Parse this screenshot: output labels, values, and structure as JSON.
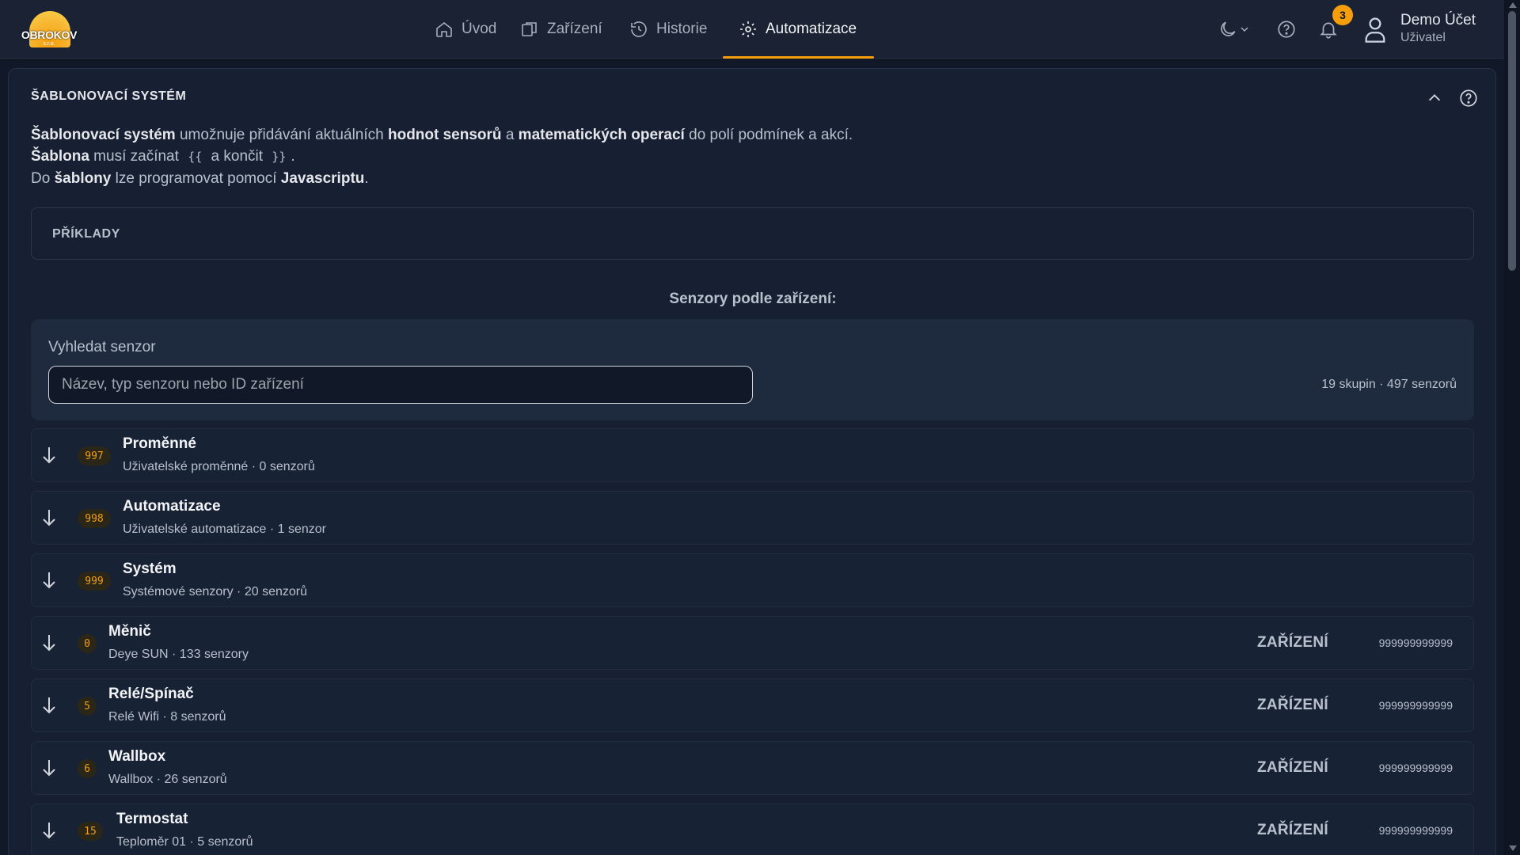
{
  "app": {
    "logo_text": "OBROKOV",
    "logo_sub": "s.r.o."
  },
  "nav": {
    "items": [
      {
        "label": "Úvod",
        "icon": "home-icon"
      },
      {
        "label": "Zařízení",
        "icon": "devices-icon"
      },
      {
        "label": "Historie",
        "icon": "history-icon"
      },
      {
        "label": "Automatizace",
        "icon": "gear-icon",
        "active": true
      }
    ]
  },
  "header": {
    "notifications_count": "3",
    "user_name": "Demo Účet",
    "user_role": "Uživatel",
    "accent_color": "#f59e0b"
  },
  "panel": {
    "title": "ŠABLONOVACÍ SYSTÉM",
    "desc": {
      "l1_b1": "Šablonovací systém",
      "l1_t1": " umožnuje přidávání aktuálních ",
      "l1_b2": "hodnot sensorů",
      "l1_t2": " a ",
      "l1_b3": "matematických operací",
      "l1_t3": " do polí podmínek a akcí.",
      "l2_b1": "Šablona",
      "l2_t1": " musí začínat ",
      "l2_c1": "{{",
      "l2_t2": " a končit ",
      "l2_c2": "}}",
      "l2_t3": ".",
      "l3_t1": "Do ",
      "l3_b1": "šablony",
      "l3_t2": " lze programovat pomocí ",
      "l3_b2": "Javascriptu",
      "l3_t3": "."
    },
    "examples_label": "PŘÍKLADY",
    "sensors_title": "Senzory podle zařízení:",
    "search": {
      "label": "Vyhledat senzor",
      "placeholder": "Název, typ senzoru nebo ID zařízení",
      "count": "19 skupin · 497 senzorů"
    }
  },
  "groups": [
    {
      "id": "997",
      "name": "Proměnné",
      "sub": "Uživatelské proměnné · 0 senzorů",
      "type": "",
      "device_id": ""
    },
    {
      "id": "998",
      "name": "Automatizace",
      "sub": "Uživatelské automatizace · 1 senzor",
      "type": "",
      "device_id": ""
    },
    {
      "id": "999",
      "name": "Systém",
      "sub": "Systémové senzory · 20 senzorů",
      "type": "",
      "device_id": ""
    },
    {
      "id": "0",
      "name": "Měnič",
      "sub": "Deye SUN · 133 senzory",
      "type": "ZAŘÍZENÍ",
      "device_id": "999999999999"
    },
    {
      "id": "5",
      "name": "Relé/Spínač",
      "sub": "Relé Wifi · 8 senzorů",
      "type": "ZAŘÍZENÍ",
      "device_id": "999999999999"
    },
    {
      "id": "6",
      "name": "Wallbox",
      "sub": "Wallbox · 26 senzorů",
      "type": "ZAŘÍZENÍ",
      "device_id": "999999999999"
    },
    {
      "id": "15",
      "name": "Termostat",
      "sub": "Teploměr 01 · 5 senzorů",
      "type": "ZAŘÍZENÍ",
      "device_id": "999999999999"
    }
  ]
}
